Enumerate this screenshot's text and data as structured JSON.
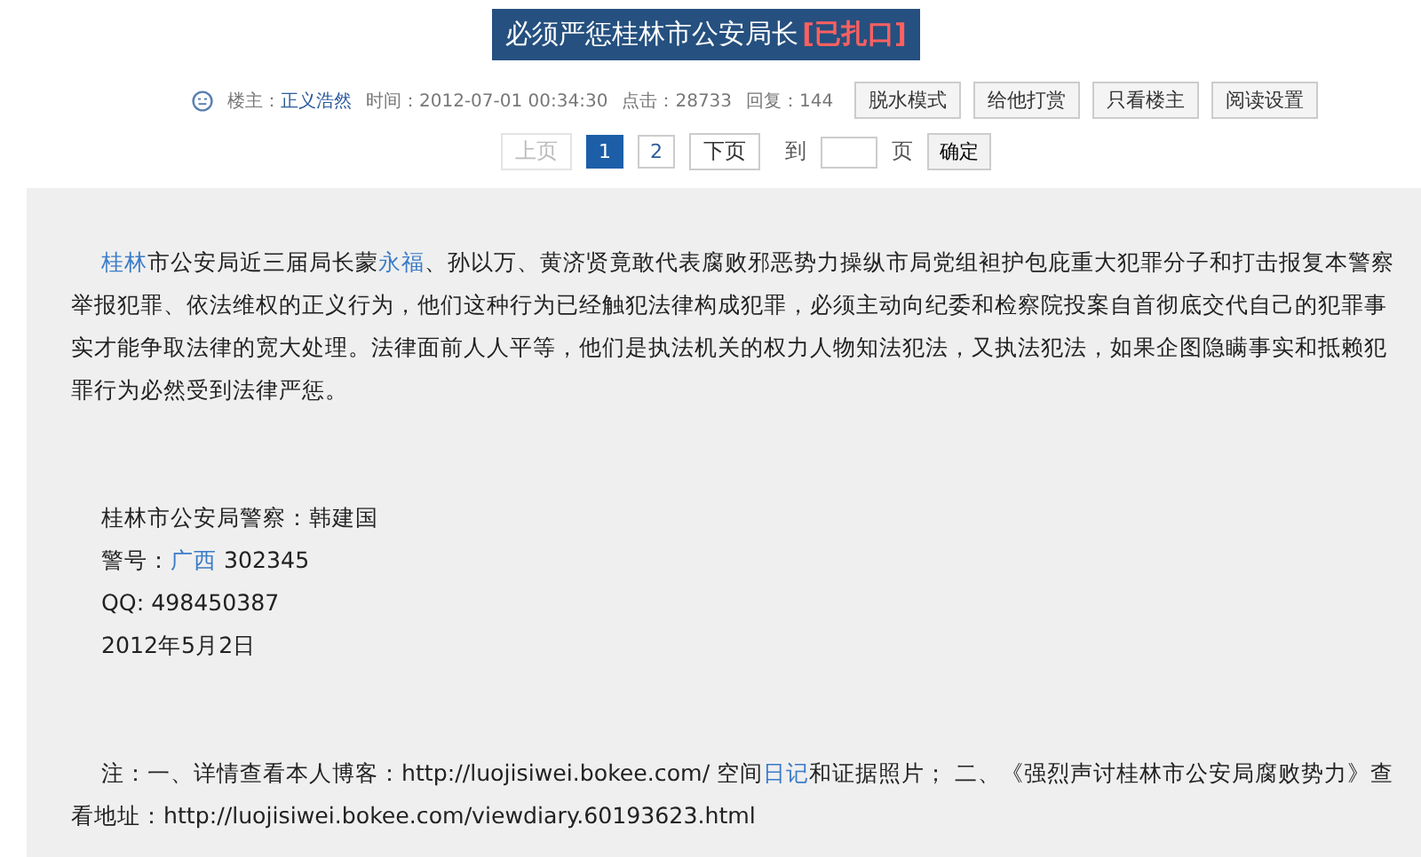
{
  "thread": {
    "title": "必须严惩桂林市公安局长",
    "status_tag": "[已扎口]"
  },
  "meta": {
    "author_label": "楼主：",
    "author": "正义浩然",
    "time": "时间：2012-07-01 00:34:30",
    "clicks": "点击：28733",
    "replies": "回复：144"
  },
  "actions": [
    "脱水模式",
    "给他打赏",
    "只看楼主",
    "阅读设置"
  ],
  "pagination": {
    "pages": [
      {
        "label": "上页",
        "kind": "nav",
        "disabled": true,
        "selected": false
      },
      {
        "label": "1",
        "kind": "page",
        "disabled": false,
        "selected": true
      },
      {
        "label": "2",
        "kind": "page",
        "disabled": false,
        "selected": false
      },
      {
        "label": "下页",
        "kind": "nav",
        "disabled": false,
        "selected": false
      }
    ],
    "goto_label": "到",
    "page_suffix": "页",
    "confirm": "确定"
  },
  "post": [
    {
      "kind": "para",
      "segments": [
        {
          "kind": "link",
          "text": "桂林"
        },
        {
          "kind": "text",
          "text": "市公安局近三届局长蒙"
        },
        {
          "kind": "link",
          "text": "永福"
        },
        {
          "kind": "text",
          "text": "、孙以万、黄济贤竟敢代表腐败邪恶势力操纵市局党组袒护包庇重大犯罪分子和打击报复本警察举报犯罪、依法维权的正义行为，他们这种行为已经触犯法律构成犯罪，必须主动向纪委和检察院投案自首彻底交代自己的犯罪事实才能争取法律的宽大处理。法律面前人人平等，他们是执法机关的权力人物知法犯法，又执法犯法，如果企图隐瞒事实和抵赖犯罪行为必然受到法律严惩。"
        }
      ]
    },
    {
      "kind": "gap"
    },
    {
      "kind": "line",
      "segments": [
        {
          "kind": "text",
          "text": "桂林市公安局警察：韩建国"
        }
      ]
    },
    {
      "kind": "line",
      "segments": [
        {
          "kind": "text",
          "text": "警号："
        },
        {
          "kind": "link",
          "text": "广西"
        },
        {
          "kind": "text",
          "text": " 302345"
        }
      ]
    },
    {
      "kind": "line",
      "segments": [
        {
          "kind": "text",
          "text": "QQ: 498450387"
        }
      ]
    },
    {
      "kind": "line",
      "segments": [
        {
          "kind": "text",
          "text": "2012年5月2日"
        }
      ]
    },
    {
      "kind": "gap"
    },
    {
      "kind": "para",
      "segments": [
        {
          "kind": "text",
          "text": "注：一、详情查看本人博客：http://luojisiwei.bokee.com/ 空间"
        },
        {
          "kind": "link",
          "text": "日记"
        },
        {
          "kind": "text",
          "text": "和证据照片；  二、《强烈声讨桂林市公安局腐败势力》查看地址：http://luojisiwei.bokee.com/viewdiary.60193623.html"
        }
      ]
    }
  ]
}
